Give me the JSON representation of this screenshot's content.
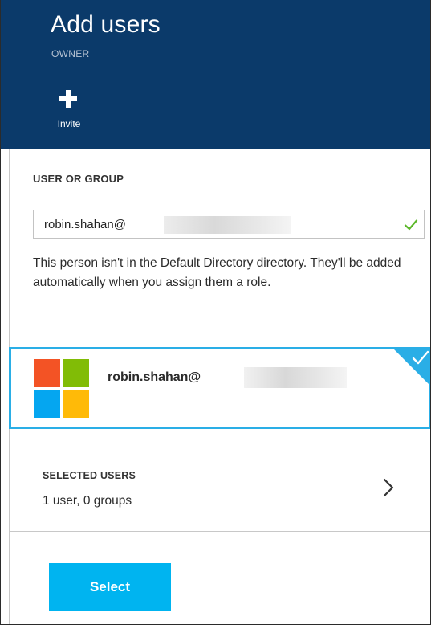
{
  "header": {
    "title": "Add users",
    "subtitle": "OWNER",
    "invite_label": "Invite"
  },
  "form": {
    "field_label": "USER OR GROUP",
    "input_value": "robin.shahan@",
    "helper_text": "This person isn't in the Default Directory directory. They'll be added automatically when you assign them a role."
  },
  "user_card": {
    "email": "robin.shahan@",
    "selected": true
  },
  "selected_users": {
    "label": "SELECTED USERS",
    "count_text": "1 user, 0 groups"
  },
  "actions": {
    "select_label": "Select"
  },
  "colors": {
    "header_bg": "#0b3a6a",
    "accent": "#00b4f0",
    "card_border": "#2aaee6",
    "success": "#5cb82a"
  },
  "icons": [
    "plus-icon",
    "check-icon",
    "microsoft-logo",
    "checkmark-corner-icon",
    "chevron-right-icon"
  ]
}
